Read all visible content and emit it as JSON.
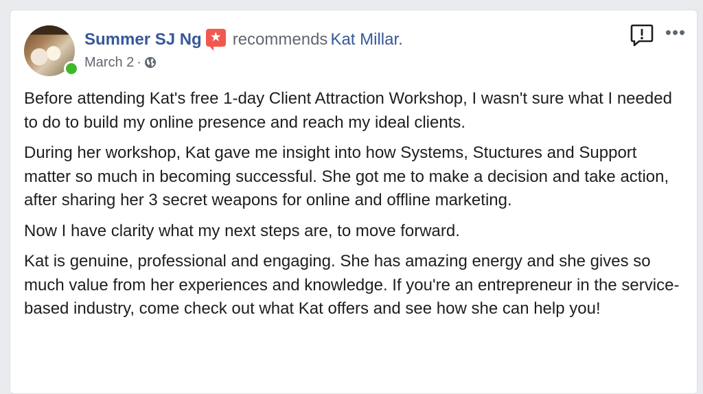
{
  "post": {
    "author": "Summer SJ Ng",
    "verb": "recommends",
    "target": "Kat Millar.",
    "date": "March 2",
    "separator": "·",
    "badge_icon": "star-badge-icon",
    "privacy_icon": "globe-icon",
    "report_icon": "report-icon",
    "more_icon": "more-icon",
    "colors": {
      "link": "#365899",
      "badge": "#f2584e",
      "online": "#42b72a",
      "meta": "#606770",
      "text": "#1c1e21"
    },
    "paragraphs": [
      "Before attending Kat's free 1-day Client Attraction Workshop, I wasn't sure what I needed to do to build my online presence and reach my ideal clients.",
      "During her workshop, Kat gave me insight into how Systems, Stuctures and Support matter so much in becoming successful. She got me to make a decision and take action, after sharing her 3 secret weapons for online and offline marketing.",
      "Now I have clarity what my next steps are, to move forward.",
      "Kat is genuine, professional and engaging. She has amazing energy and she gives so much value from her experiences and knowledge. If you're an entrepreneur in the service-based industry, come check out what Kat offers and see how she can help you!"
    ]
  }
}
